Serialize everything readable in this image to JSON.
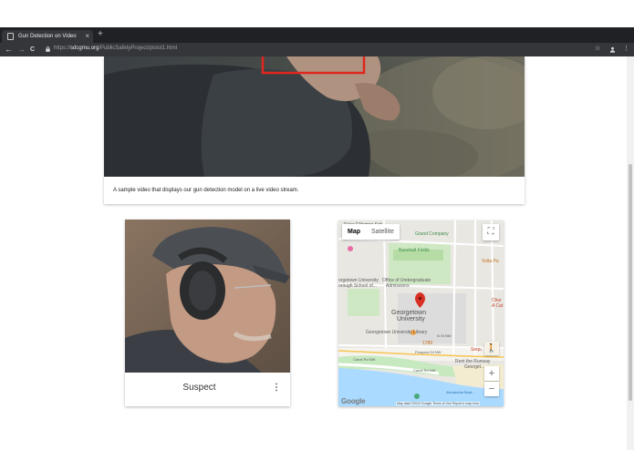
{
  "browser": {
    "tab_title": "Gun Detection on Video",
    "tab_close": "×",
    "new_tab": "+",
    "back": "←",
    "forward": "→",
    "reload": "C",
    "url_scheme": "https://",
    "url_host": "sdcgmu.org",
    "url_path": "/PublicSafetyProject/pistol1.html",
    "star": "☆",
    "more": "⋮"
  },
  "video": {
    "caption": "A sample video that displays our gun detection model on a live video stream.",
    "detection_box_color": "#e0261f"
  },
  "suspect": {
    "label": "Suspect",
    "menu": "⋮"
  },
  "map": {
    "type_map": "Map",
    "type_satellite": "Satellite",
    "fullscreen": "⛶",
    "zoom_in": "+",
    "zoom_out": "−",
    "pegman": "🚶",
    "logo": "Google",
    "footer": "Map data ©2019 Google   Terms of Use   Report a map error",
    "labels": {
      "duke": "Duke Ellington Sch...",
      "beard": "Grand Company",
      "baseball": "Baseball Fields",
      "volta": "Volta Pa",
      "gu_law": "orgetown University",
      "borough": "orough School of...",
      "office": "Office of Undergraduate",
      "admissions": "Admissions",
      "georgetown": "Georgetown",
      "university": "University",
      "library": "Georgetown University Library",
      "chur": "Chur",
      "acat": "A Cat",
      "vth": "1789",
      "prospect": "Prospect St NW",
      "n_st": "N St NW",
      "canal": "Canal Rd NW",
      "canal2": "Canal Rd NW",
      "runway": "Rent the Runway",
      "georgetn": "Georget...",
      "waterfront": "Georgetown Waterfront Park",
      "potomac": "Potomac River",
      "alexandria": "Alexandria Boat...",
      "sequ": "Sequ"
    },
    "colors": {
      "pin": "#d93025",
      "water": "#aadaff",
      "park": "#c7e9c0",
      "campus": "#e3e3e3"
    }
  }
}
